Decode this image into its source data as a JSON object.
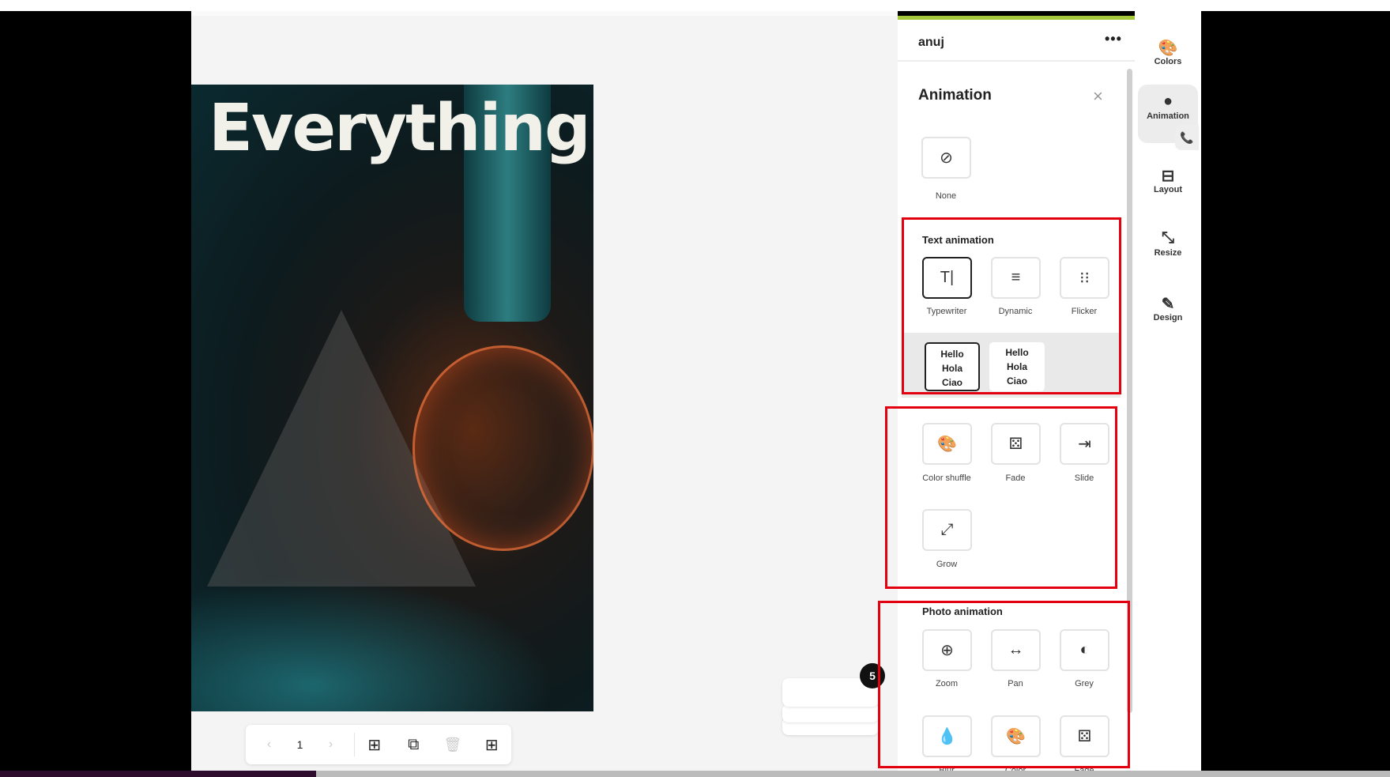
{
  "colors": {
    "accent": "#a5c73a",
    "highlight": "#e3000f",
    "canvas": "#f4f4f4"
  },
  "poster": {
    "headline": "Everything"
  },
  "toolbar": {
    "prev_icon": "chevron-left-icon",
    "page": "1",
    "next_icon": "chevron-right-icon",
    "add_page_icon": "add-page-icon",
    "duplicate_icon": "duplicate-icon",
    "delete_icon": "trash-icon",
    "grid_icon": "grid-icon"
  },
  "badge": {
    "count": "5"
  },
  "panel": {
    "user": "anuj",
    "more": "•••",
    "title": "Animation",
    "close": "×",
    "none": {
      "label": "None",
      "icon": "ban-icon"
    },
    "text_animation": {
      "title": "Text animation",
      "items": [
        {
          "label": "Typewriter",
          "icon": "T|",
          "selected": true
        },
        {
          "label": "Dynamic",
          "icon": "≡"
        },
        {
          "label": "Flicker",
          "icon": "⁝⁝"
        }
      ],
      "variants": [
        "Hello\nHola\nCiao",
        "Hello\nHola\nCiao"
      ]
    },
    "general": {
      "items": [
        {
          "label": "Color shuffle",
          "icon": "🎨"
        },
        {
          "label": "Fade",
          "icon": "⚄"
        },
        {
          "label": "Slide",
          "icon": "⇥"
        },
        {
          "label": "Grow",
          "icon": "⤢"
        }
      ]
    },
    "photo_animation": {
      "title": "Photo animation",
      "items": [
        {
          "label": "Zoom",
          "icon": "⊕"
        },
        {
          "label": "Pan",
          "icon": "↔"
        },
        {
          "label": "Grey",
          "icon": "◐"
        },
        {
          "label": "Blur",
          "icon": "💧"
        },
        {
          "label": "Color",
          "icon": "🎨"
        },
        {
          "label": "Fade",
          "icon": "⚄"
        }
      ]
    }
  },
  "rail": [
    {
      "label": "Colors",
      "icon": "🎨"
    },
    {
      "label": "Animation",
      "icon": "●",
      "active": true
    },
    {
      "label": "Layout",
      "icon": "⊟"
    },
    {
      "label": "Resize",
      "icon": "⤡"
    },
    {
      "label": "Design",
      "icon": "✎"
    }
  ]
}
